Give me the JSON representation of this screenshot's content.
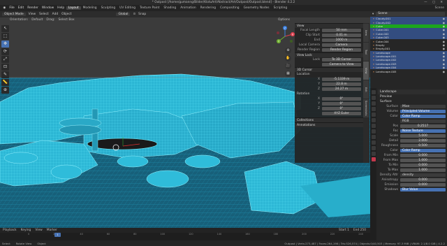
{
  "window": {
    "title": "* Outpost [/home/gumanng/Bilder/KlotuArt/Abstract/Art/Outpost/Outpost.blend] - Blender 4.2.2",
    "controls": "— ▢ ✕"
  },
  "menu": {
    "items": [
      "File",
      "Edit",
      "Render",
      "Window",
      "Help"
    ],
    "workspaces": [
      "Layout",
      "Modeling",
      "Sculpting",
      "UV Editing",
      "Texture Paint",
      "Shading",
      "Animation",
      "Rendering",
      "Compositing",
      "Geometry Nodes",
      "Scripting"
    ],
    "active_workspace": "Layout",
    "scene": "Scene"
  },
  "viewport_header": {
    "mode": "Object Mode",
    "menus": [
      "View",
      "Select",
      "Add",
      "Object"
    ],
    "transform": "Global",
    "pivot": "⊙",
    "snap": "Snap"
  },
  "viewport_header2": {
    "orientation": "Orientation:",
    "default": "Default",
    "drag": "Drag:",
    "select": "Select Box",
    "options": "Options"
  },
  "toolbar": {
    "tools": [
      "↖",
      "⬚",
      "✥",
      "⟳",
      "⤢",
      "⊡",
      "✎",
      "📏",
      "⊕"
    ],
    "active_index": 2
  },
  "gizmo": {
    "x": "X",
    "y": "Y",
    "z": "Z"
  },
  "nav_icons": [
    "⊕",
    "✋",
    "🎥",
    "▦"
  ],
  "npanel": {
    "view_section": "View",
    "view_rows": [
      {
        "k": "Focal Length",
        "v": "50 mm"
      },
      {
        "k": "Clip Start",
        "v": "0.01 m"
      },
      {
        "k": "End",
        "v": "1000 m"
      },
      {
        "k": "Local Camera",
        "v": "Camera"
      },
      {
        "k": "Render Region",
        "v": "Render Region"
      }
    ],
    "view_lock": "View Lock",
    "lock_rows": [
      {
        "k": "Lock",
        "v": "To 3D Cursor"
      },
      {
        "k": "",
        "v": "Camera to View"
      }
    ],
    "cursor_section": "3D Cursor",
    "location_label": "Location",
    "cursor_rows": [
      {
        "k": "X",
        "v": "-5.1339 m"
      },
      {
        "k": "Y",
        "v": "22.8 m"
      },
      {
        "k": "Z",
        "v": "24.27 m"
      }
    ],
    "rotation_label": "Rotation",
    "rot_rows": [
      {
        "k": "X",
        "v": "0°"
      },
      {
        "k": "Y",
        "v": "0°"
      },
      {
        "k": "Z",
        "v": "0°"
      }
    ],
    "rotation_mode": "XYZ Euler",
    "collections": "Collections",
    "annotations": "Annotations"
  },
  "ntabs": [
    "Item",
    "Tool",
    "View",
    "Edit",
    "Screenshots"
  ],
  "timeline": {
    "menus": [
      "Playback",
      "Keying",
      "View",
      "Marker"
    ],
    "frame": "1",
    "ticks": [
      "0",
      "20",
      "40",
      "60",
      "80",
      "100",
      "120",
      "140",
      "160",
      "180",
      "200",
      "220",
      "240"
    ],
    "start": "Start 1",
    "end": "End 250"
  },
  "status": {
    "left": [
      "Select",
      "Rotate View",
      "Object"
    ],
    "stats": "Outpost | Verts:273,487 | Faces:264,198 | Tris:526,574 | Objects:0/40,503 | Memory: 97.3 MiB | VRAM: 2.1/8.0 GiB | 4.2.2"
  },
  "outliner": {
    "search": "Scene",
    "rows": [
      {
        "name": "Cloudy.001",
        "sel": true,
        "act": false
      },
      {
        "name": "Cloudy.002",
        "sel": true,
        "act": false
      },
      {
        "name": "Cube",
        "sel": true,
        "act": true
      },
      {
        "name": "Cube.001",
        "sel": true,
        "act": false
      },
      {
        "name": "Cube.002",
        "sel": true,
        "act": false
      },
      {
        "name": "Cube.003",
        "sel": true,
        "act": false
      },
      {
        "name": "Cube.004",
        "sel": false,
        "act": false
      },
      {
        "name": "Empty",
        "sel": false,
        "act": false
      },
      {
        "name": "Empty.001",
        "sel": false,
        "act": false
      },
      {
        "name": "Landscape",
        "sel": true,
        "act": false
      },
      {
        "name": "Landscape.001",
        "sel": true,
        "act": false
      },
      {
        "name": "Landscape.002",
        "sel": true,
        "act": false
      },
      {
        "name": "Landscape.003",
        "sel": true,
        "act": false
      },
      {
        "name": "Landscape.004",
        "sel": true,
        "act": false
      },
      {
        "name": "Landscape.005",
        "sel": false,
        "act": false
      }
    ]
  },
  "properties": {
    "title": "Landscape",
    "sections": [
      "Preview",
      "Surface"
    ],
    "surface": {
      "k": "Surface",
      "v": "Mixe"
    },
    "nodes": [
      {
        "k": "Volume",
        "v": "Principled Volume",
        "style": "blue"
      },
      {
        "k": "Color",
        "v": "Color Ramp",
        "style": "blue"
      },
      {
        "k": "",
        "v": "RGB",
        "style": ""
      },
      {
        "k": "Pos",
        "v": "0.2517",
        "style": "num"
      },
      {
        "k": "Fac",
        "v": "Noise Texture",
        "style": "blue"
      },
      {
        "k": "Scale",
        "v": "5.000",
        "style": "num"
      },
      {
        "k": "Detail",
        "v": "2.000",
        "style": "num"
      },
      {
        "k": "Roughness",
        "v": "0.500",
        "style": "num"
      },
      {
        "k": "Color",
        "v": "Color Ramp",
        "style": "blue"
      },
      {
        "k": "From Min",
        "v": "0.000",
        "style": "num"
      },
      {
        "k": "From Max",
        "v": "1.000",
        "style": "num"
      },
      {
        "k": "To Min",
        "v": "0.000",
        "style": "num"
      },
      {
        "k": "To Max",
        "v": "1.000",
        "style": "num"
      },
      {
        "k": "Density Attr",
        "v": "density",
        "style": ""
      },
      {
        "k": "Anisotropy",
        "v": "0.000",
        "style": "num"
      },
      {
        "k": "Emission",
        "v": "0.000",
        "style": "num"
      },
      {
        "k": "Shadows",
        "v": "Blur Value",
        "style": "blue"
      }
    ]
  },
  "colors": {
    "wire": "#3fd0ec",
    "accent": "#4772b3",
    "selected": "#334d80",
    "active_green": "#1ca61c"
  }
}
